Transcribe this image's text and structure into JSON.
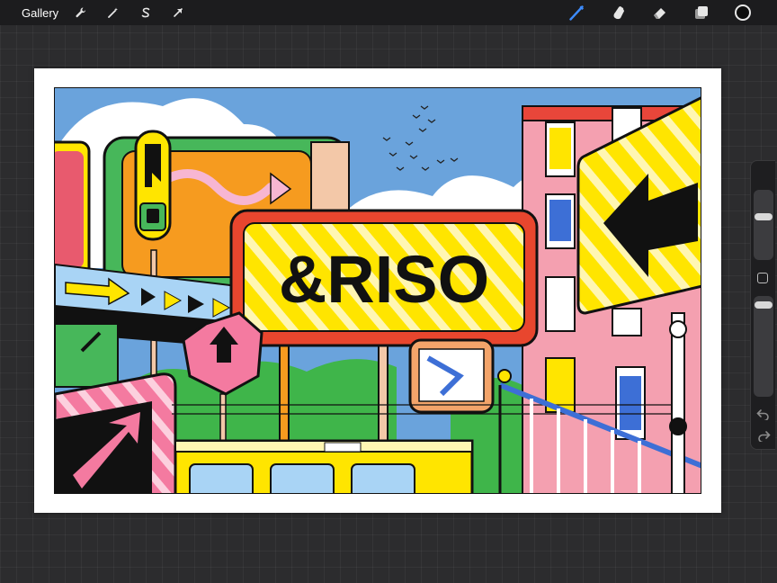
{
  "toolbar": {
    "gallery_label": "Gallery",
    "left_icons": [
      "wrench-icon",
      "magic-wand-icon",
      "selection-s-icon",
      "transform-arrow-icon"
    ],
    "right_icons": [
      "brush-icon",
      "smudge-icon",
      "eraser-icon",
      "layers-icon"
    ],
    "current_color": "#0e0e0e",
    "active_tool_color": "#3d8cff"
  },
  "artwork": {
    "main_sign_text": "&RISO",
    "colors": {
      "sky": "#6aa3dc",
      "yellow": "#ffe500",
      "red": "#ea4b2a",
      "pink": "#f49ab7",
      "green": "#3fb54a",
      "orange": "#f69b1f",
      "black": "#111111"
    }
  }
}
